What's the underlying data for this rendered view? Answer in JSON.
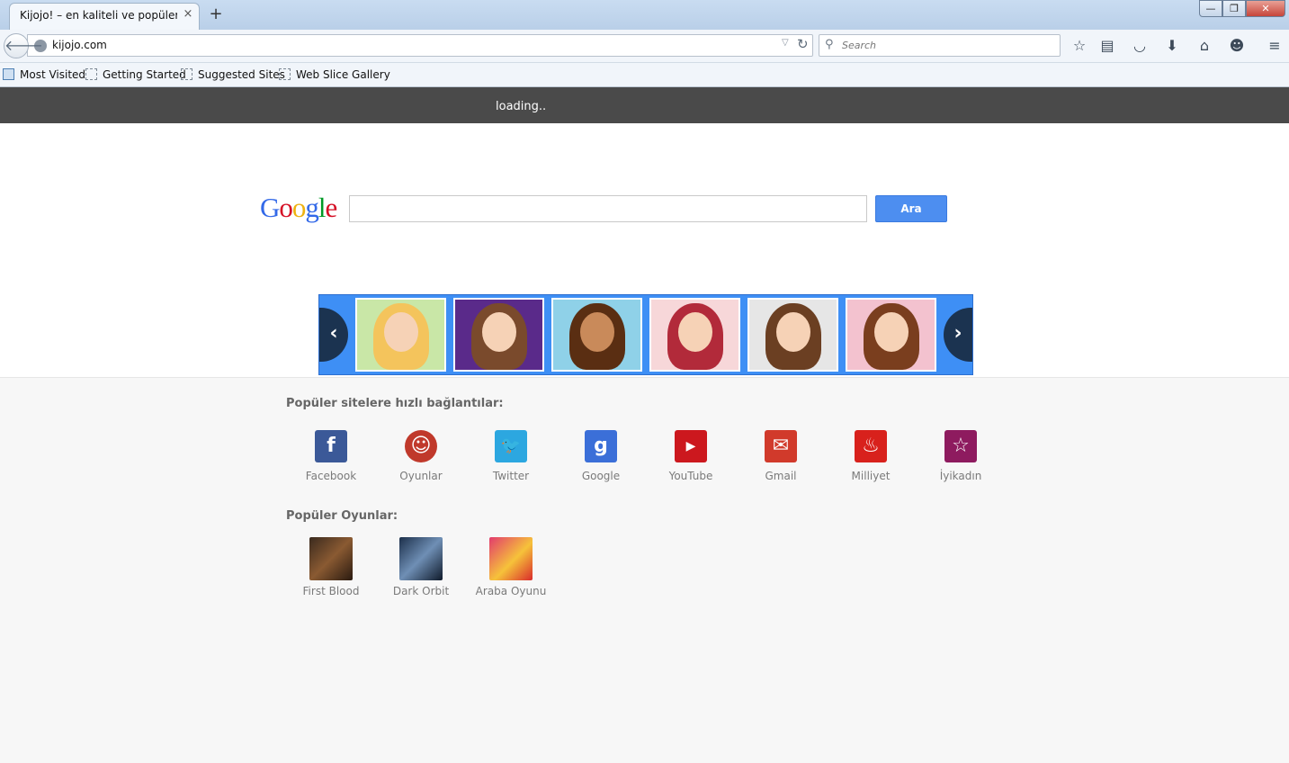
{
  "browser": {
    "tab_title": "Kijojo! – en kaliteli ve popüler ...",
    "tab_close": "×",
    "new_tab": "+",
    "window_controls": {
      "minimize": "—",
      "restore": "❐",
      "close": "✕"
    },
    "url": "kijojo.com",
    "search_placeholder": "Search",
    "bookmarks": [
      "Most Visited",
      "Getting Started",
      "Suggested Sites",
      "Web Slice Gallery"
    ],
    "toolbar_icons": [
      "bookmark-star-icon",
      "reading-list-icon",
      "pocket-icon",
      "download-icon",
      "home-icon",
      "chat-icon",
      "menu-icon"
    ]
  },
  "page": {
    "loading_text": "loading..",
    "google_logo": [
      "G",
      "o",
      "o",
      "g",
      "l",
      "e"
    ],
    "search_button": "Ara",
    "carousel": {
      "prev": "‹",
      "next": "›"
    },
    "quick_links_title": "Popüler sitelere hızlı bağlantılar:",
    "quick_links": [
      {
        "label": "Facebook",
        "color": "#3b5998",
        "glyph": "f"
      },
      {
        "label": "Oyunlar",
        "color": "#c0392b",
        "glyph": "☺"
      },
      {
        "label": "Twitter",
        "color": "#2ca7e0",
        "glyph": "🐦"
      },
      {
        "label": "Google",
        "color": "#3b6fd8",
        "glyph": "g"
      },
      {
        "label": "YouTube",
        "color": "#cc181e",
        "glyph": "▶"
      },
      {
        "label": "Gmail",
        "color": "#d13a2b",
        "glyph": "✉"
      },
      {
        "label": "Milliyet",
        "color": "#d8211c",
        "glyph": "♨"
      },
      {
        "label": "İyikadın",
        "color": "#8e1b5f",
        "glyph": "☆"
      }
    ],
    "games_title": "Popüler Oyunlar:",
    "games": [
      {
        "label": "First Blood"
      },
      {
        "label": "Dark Orbit"
      },
      {
        "label": "Araba Oyunu"
      }
    ]
  }
}
